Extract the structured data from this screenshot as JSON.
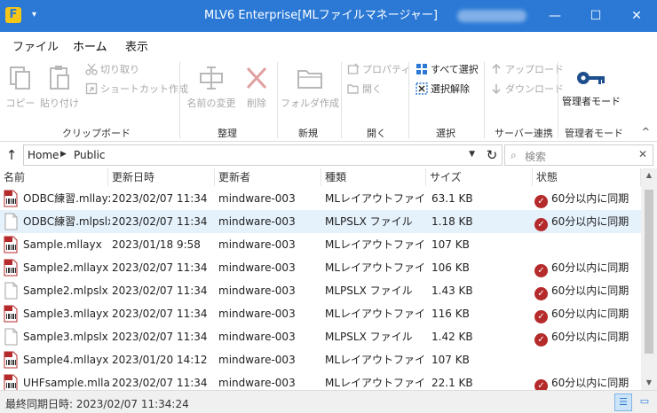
{
  "window": {
    "title": "MLV6 Enterprise[MLファイルマネージャー]",
    "app_icon_letter": "F",
    "quick_access": "▾",
    "minimize": "—",
    "maximize": "☐",
    "close": "✕"
  },
  "menu": {
    "tabs": [
      "ファイル",
      "ホーム",
      "表示"
    ],
    "active": "ホーム"
  },
  "ribbon": {
    "copy": "コピー",
    "paste": "貼り付け",
    "cut": "切り取り",
    "shortcut": "ショートカット作成",
    "group_clipboard": "クリップボード",
    "rename": "名前の変更",
    "delete": "削除",
    "group_organize": "整理",
    "new_folder": "フォルダ作成",
    "group_new": "新規",
    "properties": "プロパティ",
    "open": "開く",
    "group_open": "開く",
    "select_all": "すべて選択",
    "deselect": "選択解除",
    "group_select": "選択",
    "upload": "アップロード",
    "download": "ダウンロード",
    "group_server": "サーバー連携",
    "admin_mode": "管理者モード",
    "group_admin": "管理者モード",
    "collapse": "^"
  },
  "address": {
    "up": "↑",
    "crumbs": [
      "Home",
      "Public"
    ],
    "refresh": "↻",
    "search_placeholder": "検索",
    "clear": "✕"
  },
  "columns": [
    "名前",
    "更新日時",
    "更新者",
    "種類",
    "サイズ",
    "状態"
  ],
  "files": [
    {
      "name": "ODBC練習.mllayx",
      "date": "2023/02/07 11:34",
      "user": "mindware-003",
      "type": "MLレイアウトファイル",
      "size": "63.1 KB",
      "status": "60分以内に同期",
      "kind": "mllayx",
      "synced": true
    },
    {
      "name": "ODBC練習.mlpslx",
      "date": "2023/02/07 11:34",
      "user": "mindware-003",
      "type": "MLPSLX ファイル",
      "size": "1.18 KB",
      "status": "60分以内に同期",
      "kind": "mlpslx",
      "synced": true
    },
    {
      "name": "Sample.mllayx",
      "date": "2023/01/18 9:58",
      "user": "mindware-003",
      "type": "MLレイアウトファイル",
      "size": "107 KB",
      "status": "",
      "kind": "mllayx",
      "synced": false
    },
    {
      "name": "Sample2.mllayx",
      "date": "2023/02/07 11:34",
      "user": "mindware-003",
      "type": "MLレイアウトファイル",
      "size": "106 KB",
      "status": "60分以内に同期",
      "kind": "mllayx",
      "synced": true
    },
    {
      "name": "Sample2.mlpslx",
      "date": "2023/02/07 11:34",
      "user": "mindware-003",
      "type": "MLPSLX ファイル",
      "size": "1.43 KB",
      "status": "60分以内に同期",
      "kind": "mlpslx",
      "synced": true
    },
    {
      "name": "Sample3.mllayx",
      "date": "2023/02/07 11:34",
      "user": "mindware-003",
      "type": "MLレイアウトファイル",
      "size": "116 KB",
      "status": "60分以内に同期",
      "kind": "mllayx",
      "synced": true
    },
    {
      "name": "Sample3.mlpslx",
      "date": "2023/02/07 11:34",
      "user": "mindware-003",
      "type": "MLPSLX ファイル",
      "size": "1.42 KB",
      "status": "60分以内に同期",
      "kind": "mlpslx",
      "synced": true
    },
    {
      "name": "Sample4.mllayx",
      "date": "2023/01/20 14:12",
      "user": "mindware-003",
      "type": "MLレイアウトファイル",
      "size": "107 KB",
      "status": "",
      "kind": "mllayx",
      "synced": false
    },
    {
      "name": "UHFsample.mllayx",
      "date": "2023/02/07 11:34",
      "user": "mindware-003",
      "type": "MLレイアウトファイル",
      "size": "22.1 KB",
      "status": "60分以内に同期",
      "kind": "mllayx",
      "synced": true
    }
  ],
  "selected_row": 1,
  "status": {
    "last_sync": "最終同期日時: 2023/02/07 11:34:24"
  },
  "colors": {
    "accent": "#2b79d5",
    "sync_red": "#b52a2a",
    "selected_row": "#e5f1fb"
  }
}
